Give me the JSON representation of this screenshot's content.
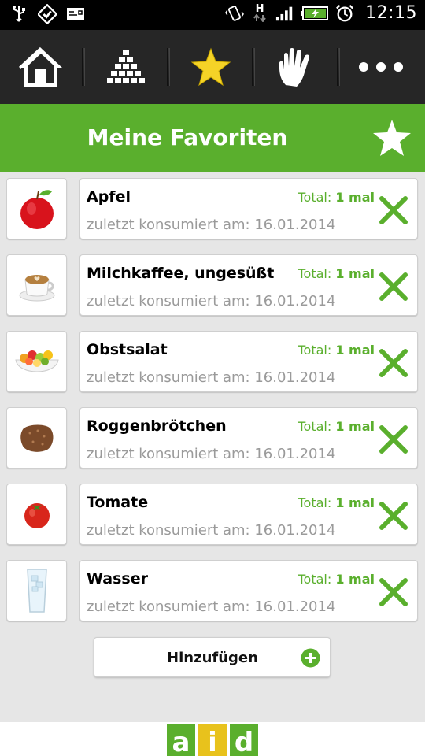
{
  "status_bar": {
    "time": "12:15",
    "network_label": "H",
    "icons": [
      "usb-icon",
      "checklist-icon",
      "mail-icon",
      "vibrate-icon",
      "network-h-icon",
      "signal-icon",
      "battery-charging-icon",
      "alarm-icon"
    ]
  },
  "toolbar": {
    "items": [
      {
        "name": "home-icon"
      },
      {
        "name": "pyramid-icon"
      },
      {
        "name": "star-icon",
        "active": true
      },
      {
        "name": "hand-icon"
      },
      {
        "name": "more-icon"
      }
    ]
  },
  "header": {
    "title": "Meine Favoriten",
    "icon": "star-icon"
  },
  "favorites": [
    {
      "name": "Apfel",
      "total_label": "Total:",
      "total_value": "1 mal",
      "date_text": "zuletzt konsumiert am: 16.01.2014",
      "image": "apple-image"
    },
    {
      "name": "Milchkaffee, ungesüßt",
      "total_label": "Total:",
      "total_value": "1 mal",
      "date_text": "zuletzt konsumiert am: 16.01.2014",
      "image": "coffee-image"
    },
    {
      "name": "Obstsalat",
      "total_label": "Total:",
      "total_value": "1 mal",
      "date_text": "zuletzt konsumiert am: 16.01.2014",
      "image": "fruit-salad-image"
    },
    {
      "name": "Roggenbrötchen",
      "total_label": "Total:",
      "total_value": "1 mal",
      "date_text": "zuletzt konsumiert am: 16.01.2014",
      "image": "bread-roll-image"
    },
    {
      "name": "Tomate",
      "total_label": "Total:",
      "total_value": "1 mal",
      "date_text": "zuletzt konsumiert am: 16.01.2014",
      "image": "tomato-image"
    },
    {
      "name": "Wasser",
      "total_label": "Total:",
      "total_value": "1 mal",
      "date_text": "zuletzt konsumiert am: 16.01.2014",
      "image": "water-glass-image"
    }
  ],
  "add_button": {
    "label": "Hinzufügen",
    "icon": "plus-icon"
  },
  "footer": {
    "logo_letters": [
      "a",
      "i",
      "d"
    ],
    "logo_colors": [
      "#5aaf2d",
      "#e8c21c",
      "#5aaf2d"
    ]
  },
  "colors": {
    "accent_green": "#5aaf2d",
    "toolbar_bg": "#262626",
    "list_bg": "#e6e6e6",
    "date_gray": "#9a9a9a",
    "star_yellow": "#f5d327"
  }
}
